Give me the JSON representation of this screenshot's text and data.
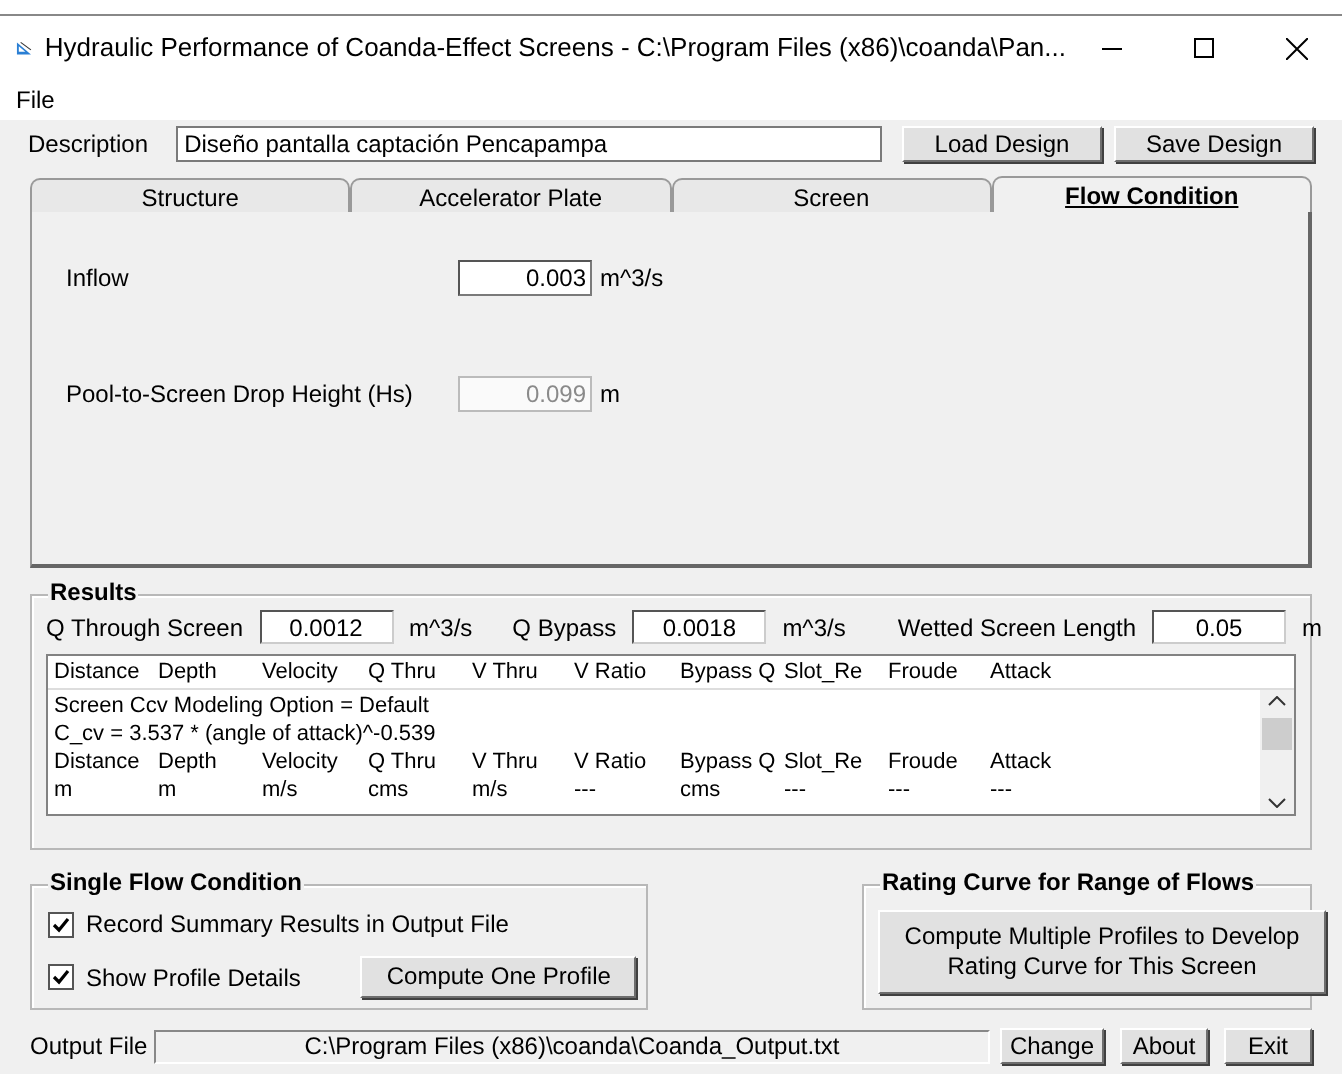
{
  "window": {
    "title": "Hydraulic Performance of Coanda-Effect Screens - C:\\Program Files (x86)\\coanda\\Pan..."
  },
  "menu": [
    "File"
  ],
  "description": {
    "label": "Description",
    "value": "Diseño pantalla captación Pencapampa"
  },
  "design_buttons": [
    "Load Design",
    "Save Design"
  ],
  "tabs": [
    {
      "label": "Structure",
      "selected": false
    },
    {
      "label": "Accelerator Plate",
      "selected": false
    },
    {
      "label": "Screen",
      "selected": false
    },
    {
      "label": "Flow Condition",
      "selected": true
    }
  ],
  "flow_fields": [
    {
      "label": "Inflow",
      "value": "0.003",
      "unit": "m^3/s",
      "disabled": false
    },
    {
      "label": "Pool-to-Screen Drop Height (Hs)",
      "value": "0.099",
      "unit": "m",
      "disabled": true
    }
  ],
  "results": {
    "title": "Results",
    "fields": [
      {
        "label": "Q Through Screen",
        "value": "0.0012",
        "unit": "m^3/s"
      },
      {
        "label": "Q Bypass",
        "value": "0.0018",
        "unit": "m^3/s"
      },
      {
        "label": "Wetted Screen Length",
        "value": "0.05",
        "unit": "m"
      }
    ],
    "header": [
      "Distance",
      "Depth",
      "Velocity",
      "Q Thru",
      "V Thru",
      "V Ratio",
      "Bypass Q",
      "Slot_Re",
      "Froude",
      "Attack"
    ],
    "log_lines": [
      "Screen Ccv Modeling Option = Default",
      "C_cv = 3.537 * (angle of attack)^-0.539"
    ],
    "log_rows": [
      [
        "Distance",
        "Depth",
        "Velocity",
        "Q Thru",
        "V Thru",
        "V Ratio",
        "Bypass Q",
        "Slot_Re",
        "Froude",
        "Attack"
      ],
      [
        "m",
        "m",
        "m/s",
        "cms",
        "m/s",
        "---",
        "cms",
        "---",
        "---",
        "---"
      ]
    ]
  },
  "single_flow": {
    "title": "Single Flow Condition",
    "options": [
      {
        "label": "Record Summary Results in Output File",
        "checked": true
      },
      {
        "label": "Show Profile Details",
        "checked": true
      }
    ],
    "button": "Compute One Profile"
  },
  "rating_curve": {
    "title": "Rating Curve for Range of Flows",
    "button": "Compute Multiple Profiles to Develop Rating Curve for This Screen"
  },
  "output_file": {
    "label": "Output File",
    "value": "C:\\Program Files (x86)\\coanda\\Coanda_Output.txt"
  },
  "bottom_buttons": [
    "Change",
    "About",
    "Exit"
  ]
}
